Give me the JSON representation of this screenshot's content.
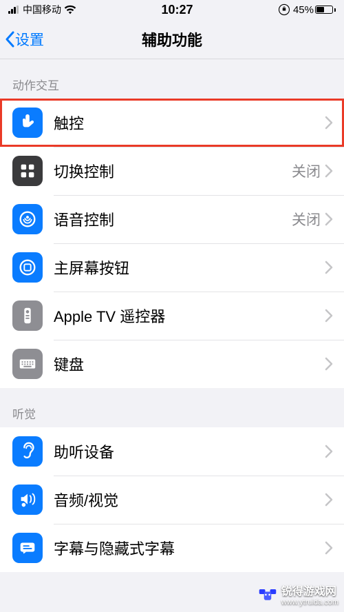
{
  "status": {
    "carrier": "中国移动",
    "time": "10:27",
    "battery_pct": "45%"
  },
  "nav": {
    "back": "设置",
    "title": "辅助功能"
  },
  "sections": {
    "motion": {
      "header": "动作交互"
    },
    "hearing": {
      "header": "听觉"
    }
  },
  "rows": {
    "touch": {
      "label": "触控"
    },
    "switch_control": {
      "label": "切换控制",
      "value": "关闭"
    },
    "voice_control": {
      "label": "语音控制",
      "value": "关闭"
    },
    "home_button": {
      "label": "主屏幕按钮"
    },
    "tv_remote": {
      "label": "Apple TV 遥控器"
    },
    "keyboard": {
      "label": "键盘"
    },
    "hearing_devices": {
      "label": "助听设备"
    },
    "audio_visual": {
      "label": "音频/视觉"
    },
    "subtitles": {
      "label": "字幕与隐藏式字幕"
    }
  },
  "watermark": {
    "text": "锐得游戏网",
    "url": "www.ytruida.com"
  }
}
